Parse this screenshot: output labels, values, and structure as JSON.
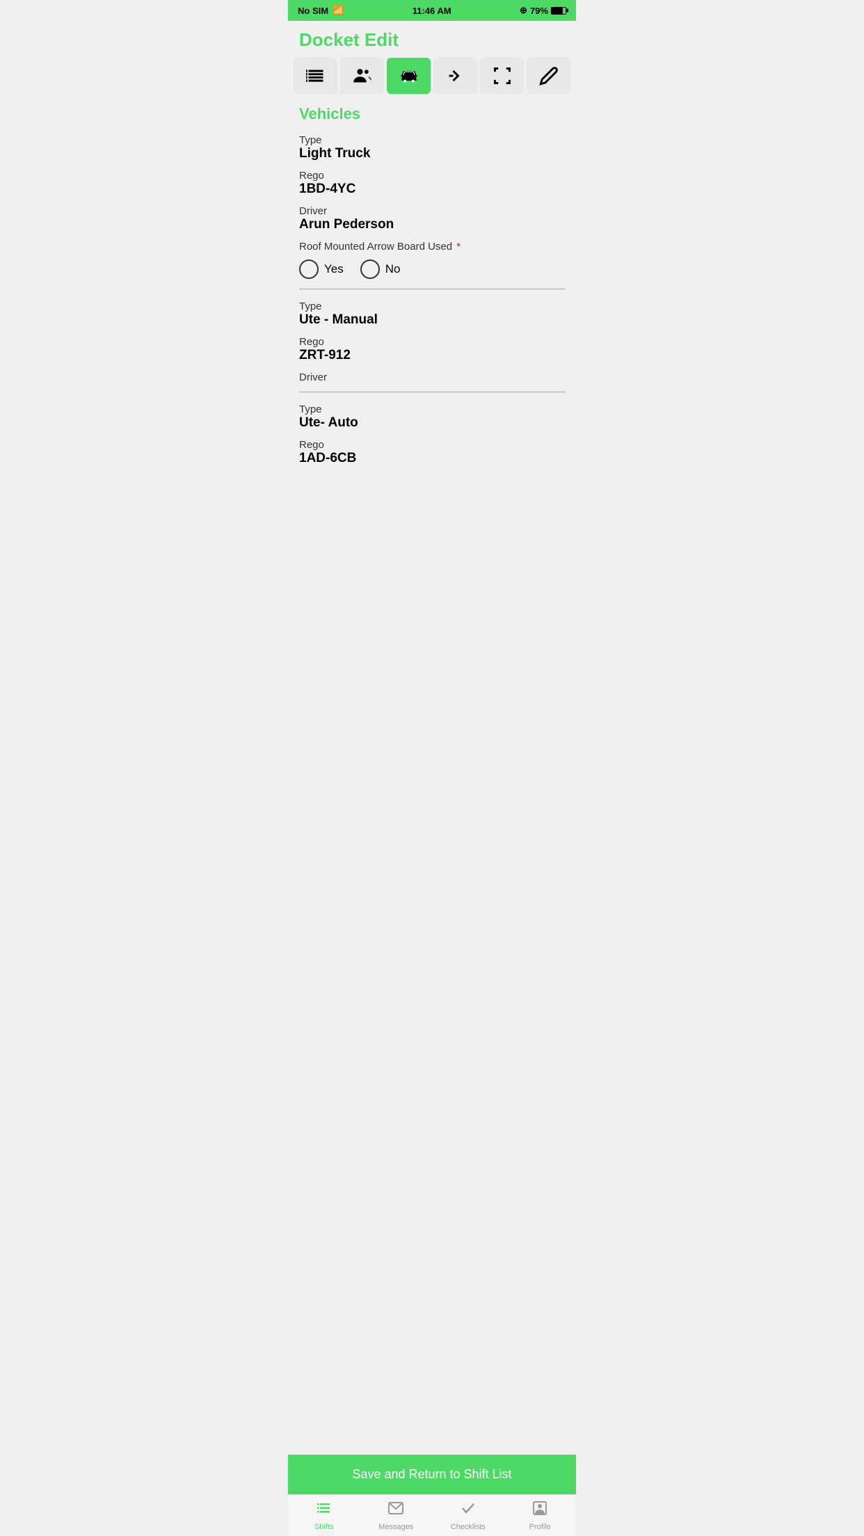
{
  "status_bar": {
    "carrier": "No SIM",
    "time": "11:46 AM",
    "battery": "79%",
    "lock_icon": "🔒"
  },
  "page": {
    "title": "Docket Edit"
  },
  "toolbar": {
    "buttons": [
      {
        "id": "list",
        "label": "list",
        "active": false
      },
      {
        "id": "people",
        "label": "people",
        "active": false
      },
      {
        "id": "vehicle",
        "label": "vehicle",
        "active": true
      },
      {
        "id": "arrow",
        "label": "arrow",
        "active": false
      },
      {
        "id": "frame",
        "label": "frame",
        "active": false
      },
      {
        "id": "edit",
        "label": "edit",
        "active": false
      }
    ]
  },
  "vehicles_section": {
    "title": "Vehicles",
    "vehicles": [
      {
        "type_label": "Type",
        "type_value": "Light Truck",
        "rego_label": "Rego",
        "rego_value": "1BD-4YC",
        "driver_label": "Driver",
        "driver_value": "Arun Pederson",
        "arrow_board_label": "Roof Mounted Arrow Board Used",
        "required": true,
        "yes_label": "Yes",
        "no_label": "No",
        "has_divider": true
      },
      {
        "type_label": "Type",
        "type_value": "Ute - Manual",
        "rego_label": "Rego",
        "rego_value": "ZRT-912",
        "driver_label": "Driver",
        "driver_value": "",
        "has_divider": true
      },
      {
        "type_label": "Type",
        "type_value": "Ute- Auto",
        "rego_label": "Rego",
        "rego_value": "1AD-6CB",
        "has_divider": false
      }
    ]
  },
  "save_button": {
    "label": "Save and Return to Shift List"
  },
  "bottom_nav": {
    "items": [
      {
        "id": "shifts",
        "label": "Shifts",
        "active": true
      },
      {
        "id": "messages",
        "label": "Messages",
        "active": false
      },
      {
        "id": "checklists",
        "label": "Checklists",
        "active": false
      },
      {
        "id": "profile",
        "label": "Profile",
        "active": false
      }
    ]
  }
}
